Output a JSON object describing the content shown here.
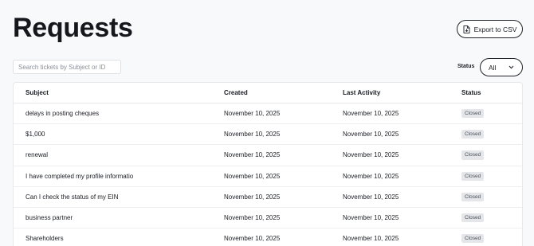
{
  "header": {
    "title": "Requests",
    "export_label": "Export to CSV"
  },
  "filters": {
    "search_placeholder": "Search tickets by Subject or ID",
    "status_label": "Status",
    "status_value": "All"
  },
  "table": {
    "columns": [
      "Subject",
      "Created",
      "Last Activity",
      "Status"
    ],
    "rows": [
      {
        "subject": "delays in posting cheques",
        "created": "November 10, 2025",
        "last_activity": "November 10, 2025",
        "status": "Closed"
      },
      {
        "subject": "$1,000",
        "created": "November 10, 2025",
        "last_activity": "November 10, 2025",
        "status": "Closed"
      },
      {
        "subject": "renewal",
        "created": "November 10, 2025",
        "last_activity": "November 10, 2025",
        "status": "Closed"
      },
      {
        "subject": "I have completed my profile informatio",
        "created": "November 10, 2025",
        "last_activity": "November 10, 2025",
        "status": "Closed"
      },
      {
        "subject": "Can I check the status of my EIN",
        "created": "November 10, 2025",
        "last_activity": "November 10, 2025",
        "status": "Closed"
      },
      {
        "subject": "business partner",
        "created": "November 10, 2025",
        "last_activity": "November 10, 2025",
        "status": "Closed"
      },
      {
        "subject": "Shareholders",
        "created": "November 10, 2025",
        "last_activity": "November 10, 2025",
        "status": "Closed"
      }
    ]
  }
}
